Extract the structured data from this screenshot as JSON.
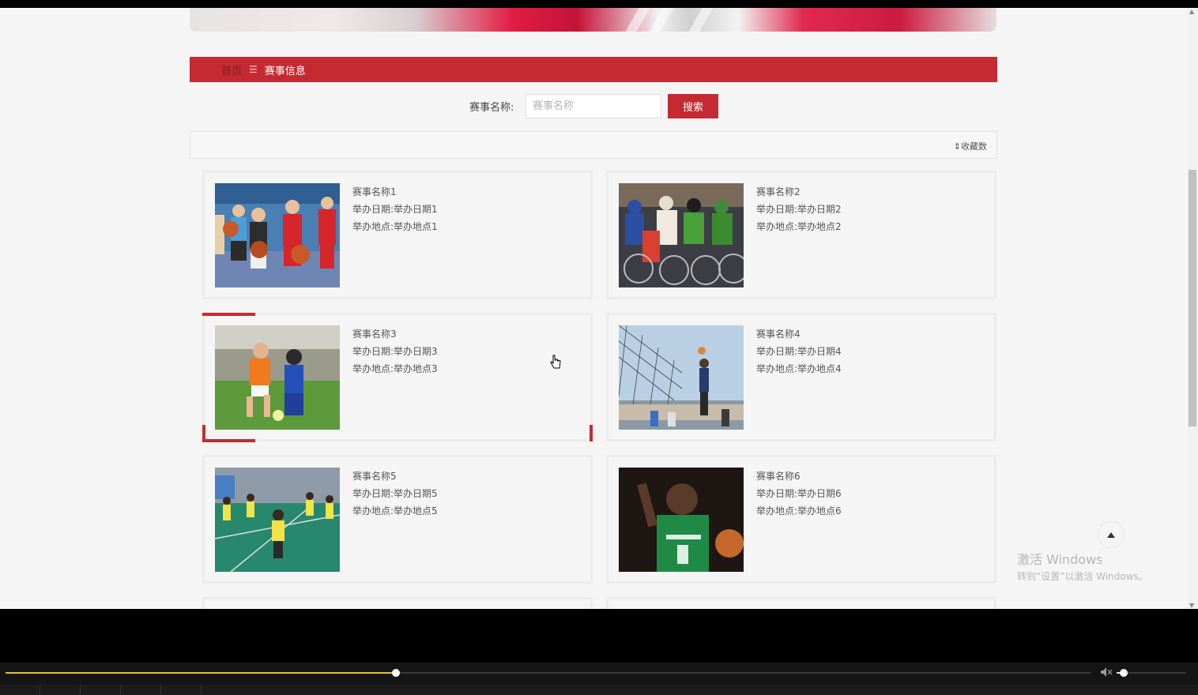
{
  "breadcrumb": {
    "home": "首页",
    "separator": "☰",
    "current": "赛事信息"
  },
  "search": {
    "label": "赛事名称:",
    "placeholder": "赛事名称",
    "button": "搜索"
  },
  "sort": {
    "label": "收藏数",
    "icon": "sort-icon"
  },
  "cards": [
    {
      "name": "赛事名称1",
      "date": "举办日期:举办日期1",
      "place": "举办地点:举办地点1",
      "image": "kids-basketball"
    },
    {
      "name": "赛事名称2",
      "date": "举办日期:举办日期2",
      "place": "举办地点:举办地点2",
      "image": "cycling-race"
    },
    {
      "name": "赛事名称3",
      "date": "举办日期:举办日期3",
      "place": "举办地点:举办地点3",
      "image": "kids-football"
    },
    {
      "name": "赛事名称4",
      "date": "举办日期:举办日期4",
      "place": "举办地点:举办地点4",
      "image": "volleyball"
    },
    {
      "name": "赛事名称5",
      "date": "举办日期:举办日期5",
      "place": "举办地点:举办地点5",
      "image": "badminton"
    },
    {
      "name": "赛事名称6",
      "date": "举办日期:举办日期6",
      "place": "举办地点:举办地点6",
      "image": "boston-basketball"
    }
  ],
  "watermark": {
    "title": "激活 Windows",
    "subtitle": "转到“设置”以激活 Windows。"
  },
  "player": {
    "seek_progress": 0.36,
    "volume": 0.1
  },
  "colors": {
    "accent": "#c52a33",
    "seek": "#e6c229"
  }
}
